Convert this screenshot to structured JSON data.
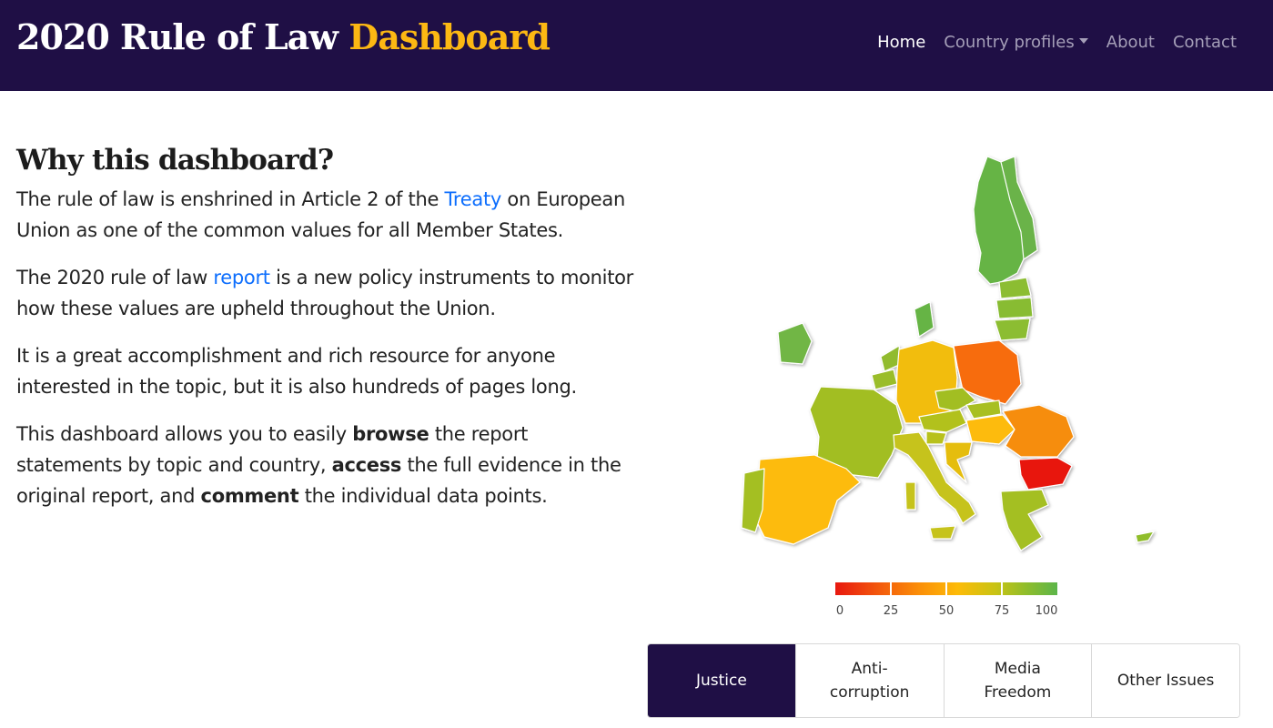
{
  "header": {
    "brand_main": "2020 Rule of Law ",
    "brand_highlight": "Dashboard",
    "nav": {
      "home": "Home",
      "country_profiles": "Country profiles",
      "about": "About",
      "contact": "Contact"
    }
  },
  "intro": {
    "title": "Why this dashboard?",
    "p1_before": "The rule of law is enshrined in Article 2 of the ",
    "p1_link": "Treaty",
    "p1_after": " on European Union as one of the common values for all Member States.",
    "p2_before": "The 2020 rule of law ",
    "p2_link": "report",
    "p2_after": " is a new policy instruments to monitor how these values are upheld throughout the Union.",
    "p3": "It is a great accomplishment and rich resource for anyone interested in the topic, but it is also hundreds of pages long.",
    "p4_a": "This dashboard allows you to easily ",
    "p4_b": "browse",
    "p4_c": " the report statements by topic and country, ",
    "p4_d": "access",
    "p4_e": " the full evidence in the original report, and ",
    "p4_f": "comment",
    "p4_g": " the individual data points."
  },
  "legend": {
    "ticks": [
      "0",
      "25",
      "50",
      "75",
      "100"
    ],
    "colors": [
      "#e8180f",
      "#fb8f08",
      "#fdbb08",
      "#c9c314",
      "#5cb54a"
    ]
  },
  "tabs": {
    "justice": "Justice",
    "anticorruption": "Anti-\ncorruption",
    "media": "Media\nFreedom",
    "other": "Other Issues"
  }
}
